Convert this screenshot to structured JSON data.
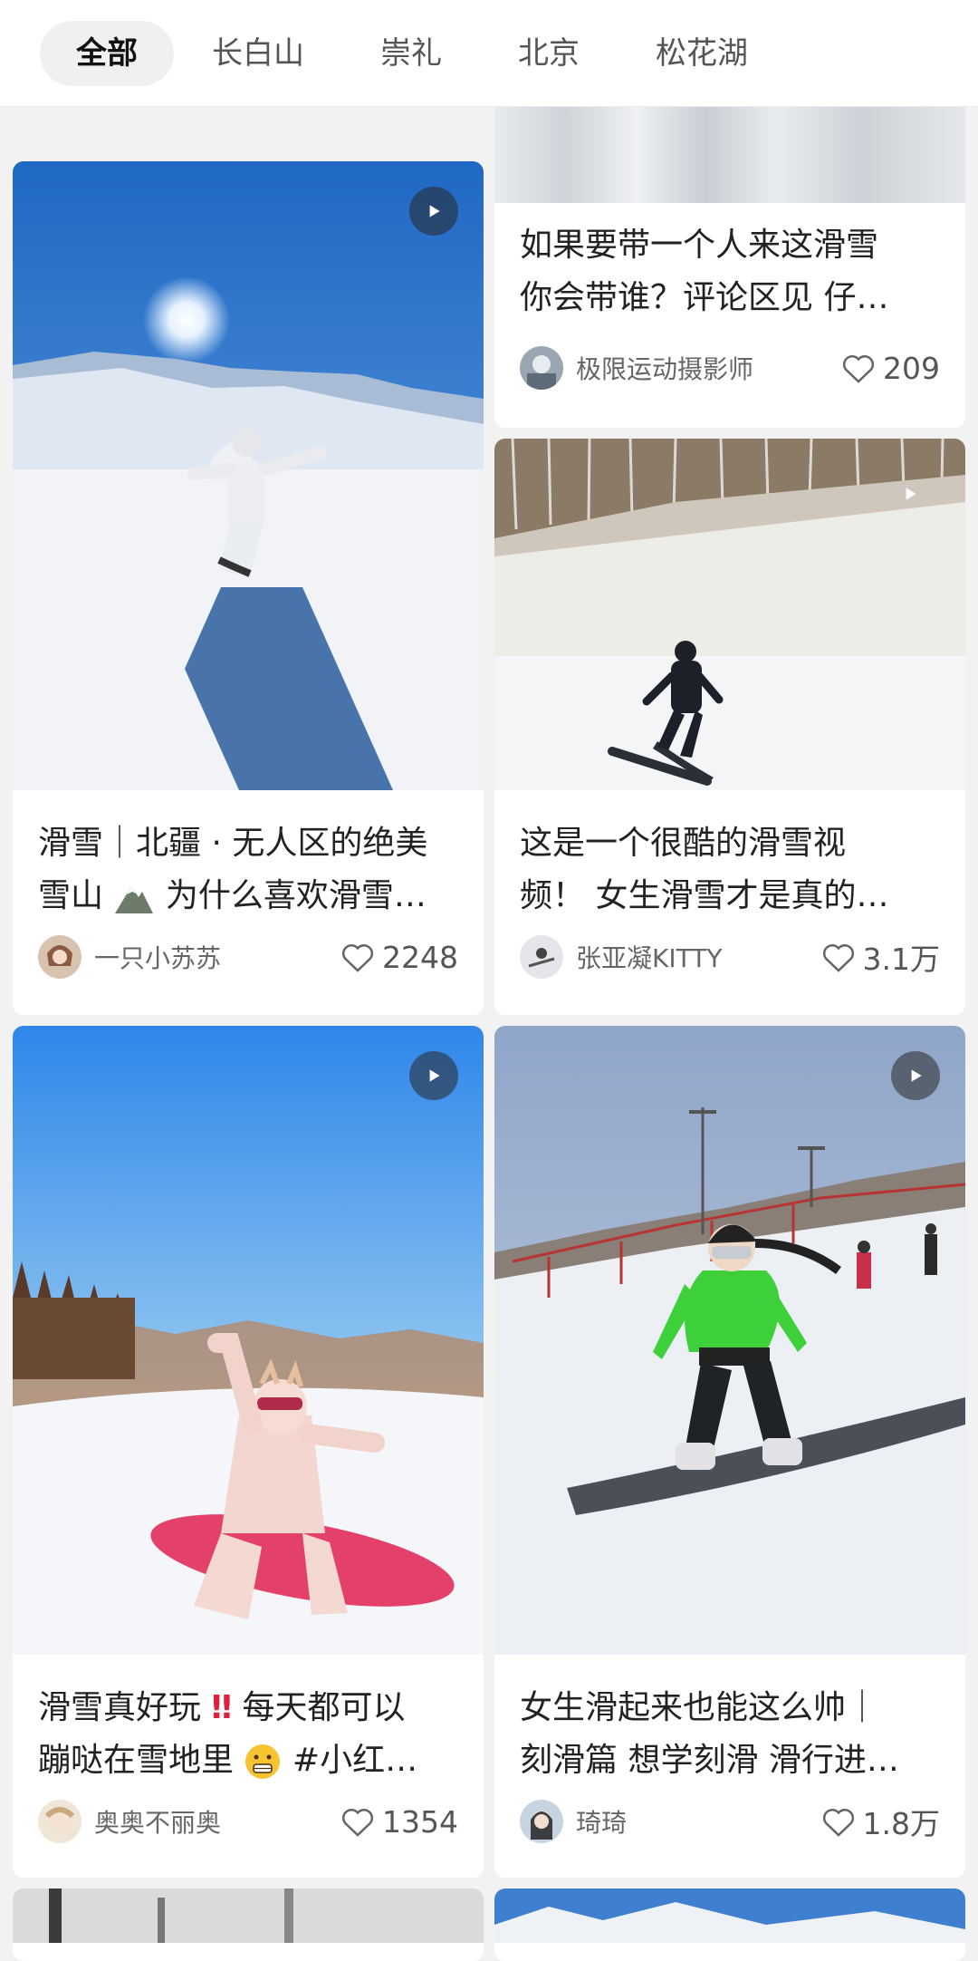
{
  "tabs": [
    "全部",
    "长白山",
    "崇礼",
    "北京",
    "松花湖"
  ],
  "cards": [
    {
      "title_line1": "",
      "title_line2": "",
      "author": "",
      "likes": ""
    },
    {
      "title_line1": "如果要带一个人来这滑雪",
      "title_line2": "你会带谁？评论区见 仔…",
      "author": "极限运动摄影师",
      "likes": "209"
    },
    {
      "title_line1": "滑雪｜北疆 · 无人区的绝美",
      "title_line2_a": "雪山",
      "title_line2_b": "为什么喜欢滑雪…",
      "author": "一只小苏苏",
      "likes": "2248"
    },
    {
      "title_line1": "这是一个很酷的滑雪视",
      "title_line2": "频！ 女生滑雪才是真的…",
      "author": "张亚凝KITTY",
      "likes": "3.1万"
    },
    {
      "title_line1_a": "滑雪真好玩",
      "title_line1_b": "‼",
      "title_line1_c": "每天都可以",
      "title_line2_a": "蹦哒在雪地里",
      "title_line2_b": "#小红…",
      "author": "奥奥不丽奥",
      "likes": "1354"
    },
    {
      "title_line1": "女生滑起来也能这么帅｜",
      "title_line2": "刻滑篇 想学刻滑 滑行进…",
      "author": "琦琦",
      "likes": "1.8万"
    }
  ],
  "colors": {
    "heart_outline": "#666666",
    "play_bg": "#3a3a3a"
  }
}
